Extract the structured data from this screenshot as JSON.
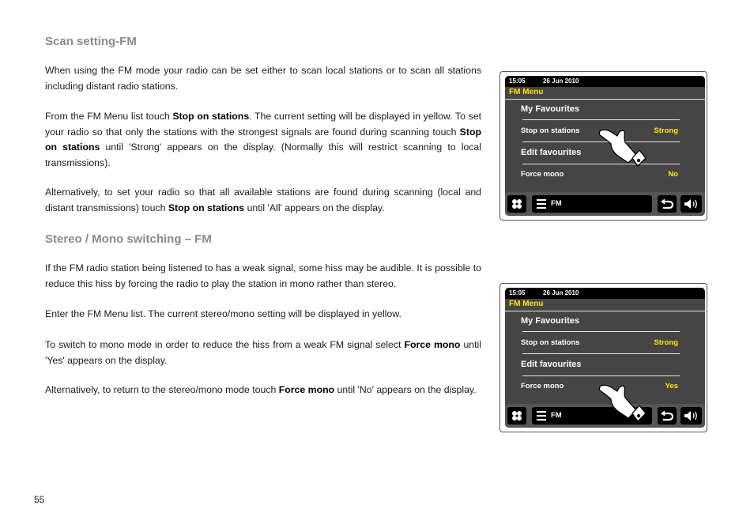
{
  "page": {
    "number": "55"
  },
  "sections": [
    {
      "heading": "Scan setting-FM",
      "paragraphs": [
        {
          "segments": [
            {
              "text": "When using the FM mode your radio can be set either to scan local stations or to scan all stations including distant radio stations.",
              "bold": false
            }
          ]
        },
        {
          "segments": [
            {
              "text": "From the FM Menu list touch ",
              "bold": false
            },
            {
              "text": "Stop on stations",
              "bold": true
            },
            {
              "text": ". The current setting will be displayed in yellow. To set your radio so that only the stations with the strongest signals are found during scanning touch ",
              "bold": false
            },
            {
              "text": "Stop on stations",
              "bold": true
            },
            {
              "text": " until 'Strong' appears on the display. (Normally this will restrict scanning to local transmissions).",
              "bold": false
            }
          ]
        },
        {
          "segments": [
            {
              "text": "Alternatively, to set your radio so that all available stations are found during scanning (local and distant transmissions) touch ",
              "bold": false
            },
            {
              "text": "Stop on stations",
              "bold": true
            },
            {
              "text": " until 'All' appears on the display.",
              "bold": false
            }
          ]
        }
      ]
    },
    {
      "heading": "Stereo / Mono switching – FM",
      "paragraphs": [
        {
          "segments": [
            {
              "text": "If the FM radio station being listened to has a weak signal, some hiss may be audible. It is possible to reduce this hiss by forcing the radio to play the station in mono rather than stereo.",
              "bold": false
            }
          ]
        },
        {
          "segments": [
            {
              "text": "Enter the FM Menu list. The current stereo/mono setting will be displayed in yellow.",
              "bold": false
            }
          ]
        },
        {
          "segments": [
            {
              "text": "To switch to mono mode in order to reduce the hiss from a weak FM signal select ",
              "bold": false
            },
            {
              "text": "Force mono",
              "bold": true
            },
            {
              "text": " until 'Yes' appears on the display.",
              "bold": false
            }
          ]
        },
        {
          "segments": [
            {
              "text": "Alternatively, to return to the stereo/mono mode touch ",
              "bold": false
            },
            {
              "text": "Force mono",
              "bold": true
            },
            {
              "text": " until 'No' appears on the display.",
              "bold": false
            }
          ]
        }
      ]
    }
  ],
  "devices": [
    {
      "time": "15:05",
      "date": "26 Jun 2010",
      "menu_title": "FM Menu",
      "items": [
        {
          "label": "My Favourites",
          "value": ""
        },
        {
          "label": "Stop on stations",
          "value": "Strong"
        },
        {
          "label": "Edit favourites",
          "value": ""
        },
        {
          "label": "Force mono",
          "value": "No"
        }
      ],
      "mode_label": "FM",
      "pointing_at": "Stop on stations",
      "icons": [
        "apps-grid-icon",
        "menu-list-icon",
        "back-arrow-icon",
        "volume-icon",
        "pointing-hand-icon"
      ]
    },
    {
      "time": "15:05",
      "date": "26 Jun 2010",
      "menu_title": "FM Menu",
      "items": [
        {
          "label": "My Favourites",
          "value": ""
        },
        {
          "label": "Stop on stations",
          "value": "Strong"
        },
        {
          "label": "Edit favourites",
          "value": ""
        },
        {
          "label": "Force mono",
          "value": "Yes"
        }
      ],
      "mode_label": "FM",
      "pointing_at": "Force mono",
      "icons": [
        "apps-grid-icon",
        "menu-list-icon",
        "back-arrow-icon",
        "volume-icon",
        "pointing-hand-icon"
      ]
    }
  ],
  "colors": {
    "heading": "#8a8a8a",
    "highlight_yellow": "#ffe500",
    "screen_bg": "#454545"
  }
}
